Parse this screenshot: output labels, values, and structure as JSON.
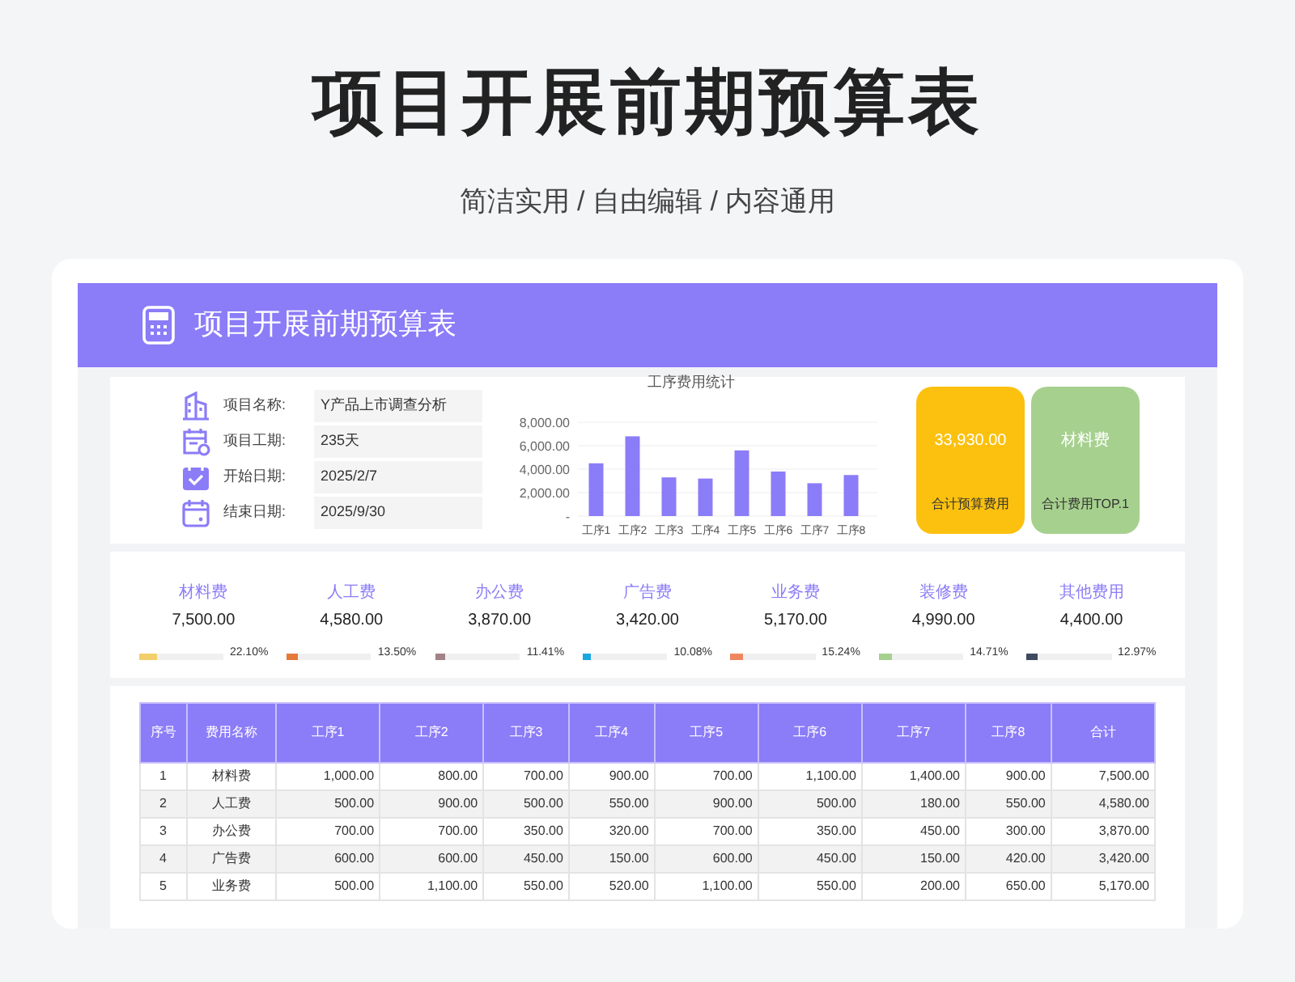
{
  "page": {
    "title": "项目开展前期预算表",
    "subtitle": "简洁实用 / 自由编辑 / 内容通用"
  },
  "sheet": {
    "title": "项目开展前期预算表",
    "info": [
      {
        "kind": "building",
        "label": "项目名称:",
        "value": "Y产品上市调查分析"
      },
      {
        "kind": "duration",
        "label": "项目工期:",
        "value": "235天"
      },
      {
        "kind": "start",
        "label": "开始日期:",
        "value": "2025/2/7"
      },
      {
        "kind": "end",
        "label": "结束日期:",
        "value": "2025/9/30"
      }
    ],
    "chart_data": {
      "type": "bar",
      "title": "工序费用统计",
      "categories": [
        "工序1",
        "工序2",
        "工序3",
        "工序4",
        "工序5",
        "工序6",
        "工序7",
        "工序8"
      ],
      "series": [
        {
          "color": "#8b7cf8",
          "values": [
            4500,
            6800,
            3300,
            3200,
            5600,
            3800,
            2800,
            3500
          ]
        }
      ],
      "grid": true,
      "ylim": [
        0,
        8000
      ],
      "yticks": [
        {
          "value": 0,
          "label": "-"
        },
        {
          "value": 2000,
          "label": "2,000.00"
        },
        {
          "value": 4000,
          "label": "4,000.00"
        },
        {
          "value": 6000,
          "label": "6,000.00"
        },
        {
          "value": 8000,
          "label": "8,000.00"
        }
      ]
    },
    "kpis": [
      {
        "value": "33,930.00",
        "label": "合计预算费用",
        "color": "#fcc10f"
      },
      {
        "value": "材料费",
        "label": "合计费用TOP.1",
        "color": "#a6d08e"
      }
    ],
    "categories": [
      {
        "name": "材料费",
        "amount": "7,500.00",
        "percent": "22.10%",
        "level": 0.221,
        "color": "#f2cf6b"
      },
      {
        "name": "人工费",
        "amount": "4,580.00",
        "percent": "13.50%",
        "level": 0.135,
        "color": "#e4793a"
      },
      {
        "name": "办公费",
        "amount": "3,870.00",
        "percent": "11.41%",
        "level": 0.1141,
        "color": "#a08287"
      },
      {
        "name": "广告费",
        "amount": "3,420.00",
        "percent": "10.08%",
        "level": 0.1008,
        "color": "#1aa6e0"
      },
      {
        "name": "业务费",
        "amount": "5,170.00",
        "percent": "15.24%",
        "level": 0.1524,
        "color": "#ef8660"
      },
      {
        "name": "装修费",
        "amount": "4,990.00",
        "percent": "14.71%",
        "level": 0.1471,
        "color": "#a6d08e"
      },
      {
        "name": "其他费用",
        "amount": "4,400.00",
        "percent": "12.97%",
        "level": 0.1297,
        "color": "#3e4a5e"
      }
    ],
    "table": {
      "columns": [
        "序号",
        "费用名称",
        "工序1",
        "工序2",
        "工序3",
        "工序4",
        "工序5",
        "工序6",
        "工序7",
        "工序8",
        "合计"
      ],
      "rows": [
        [
          "1",
          "材料费",
          "1,000.00",
          "800.00",
          "700.00",
          "900.00",
          "700.00",
          "1,100.00",
          "1,400.00",
          "900.00",
          "7,500.00"
        ],
        [
          "2",
          "人工费",
          "500.00",
          "900.00",
          "500.00",
          "550.00",
          "900.00",
          "500.00",
          "180.00",
          "550.00",
          "4,580.00"
        ],
        [
          "3",
          "办公费",
          "700.00",
          "700.00",
          "350.00",
          "320.00",
          "700.00",
          "350.00",
          "450.00",
          "300.00",
          "3,870.00"
        ],
        [
          "4",
          "广告费",
          "600.00",
          "600.00",
          "450.00",
          "150.00",
          "600.00",
          "450.00",
          "150.00",
          "420.00",
          "3,420.00"
        ],
        [
          "5",
          "业务费",
          "500.00",
          "1,100.00",
          "550.00",
          "520.00",
          "1,100.00",
          "550.00",
          "200.00",
          "650.00",
          "5,170.00"
        ]
      ]
    }
  }
}
